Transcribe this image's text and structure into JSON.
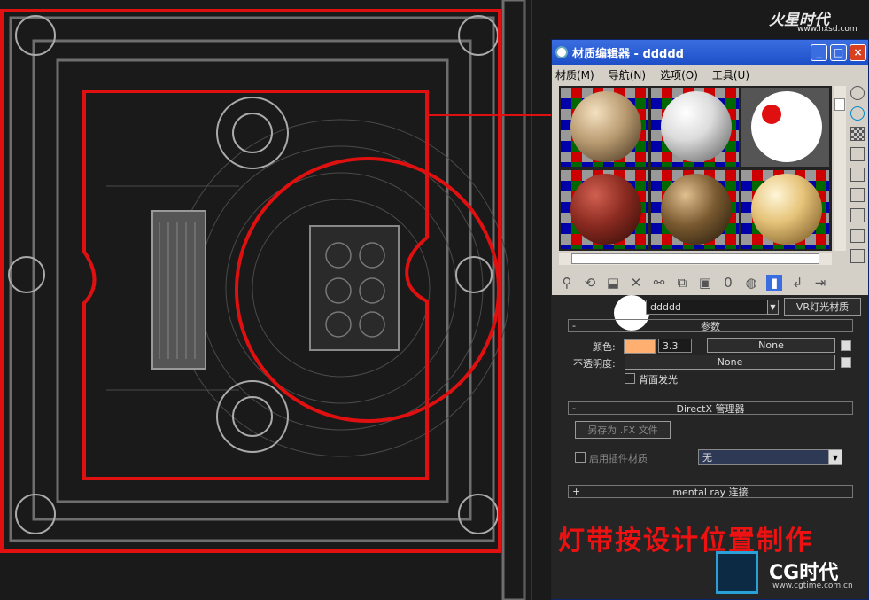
{
  "viewport": {
    "label": "ceiling-wireframe-view"
  },
  "watermark_top": {
    "logo": "火星时代",
    "url": "www.hxsd.com"
  },
  "window": {
    "title": "材质编辑器 - ddddd",
    "controls": [
      "_",
      "□",
      "×"
    ],
    "menu": [
      "材质(M)",
      "导航(N)",
      "选项(O)",
      "工具(U)"
    ]
  },
  "samples": {
    "slots": [
      {
        "name": "marble",
        "color": "#b89a70"
      },
      {
        "name": "gray",
        "color": "#dcdcdc"
      },
      {
        "name": "white-selected",
        "color": "#ffffff"
      },
      {
        "name": "red-fabric",
        "color": "#8a2a20"
      },
      {
        "name": "wood",
        "color": "#7a5a30"
      },
      {
        "name": "gold",
        "color": "#e6c47a"
      }
    ]
  },
  "material": {
    "name": "ddddd",
    "type_button": "VR灯光材质"
  },
  "params": {
    "rollout_title": "参数",
    "color_label": "颜色:",
    "color_swatch": "#ffb070",
    "multiplier": "3.3",
    "color_map": "None",
    "opacity_label": "不透明度:",
    "opacity_map": "None",
    "backside_label": "背面发光"
  },
  "directx": {
    "rollout_title": "DirectX 管理器",
    "save_fx": "另存为 .FX 文件",
    "enable_plugin": "启用插件材质",
    "plugin_value": "无"
  },
  "mentalray": {
    "rollout_title": "mental ray 连接"
  },
  "annotation": {
    "text": "灯带按设计位置制作"
  },
  "watermark_bottom": {
    "logo": "CG时代",
    "url": "www.cgtime.com.cn"
  },
  "colors": {
    "highlight_red": "#e01010",
    "window_blue": "#1d4fc8"
  }
}
